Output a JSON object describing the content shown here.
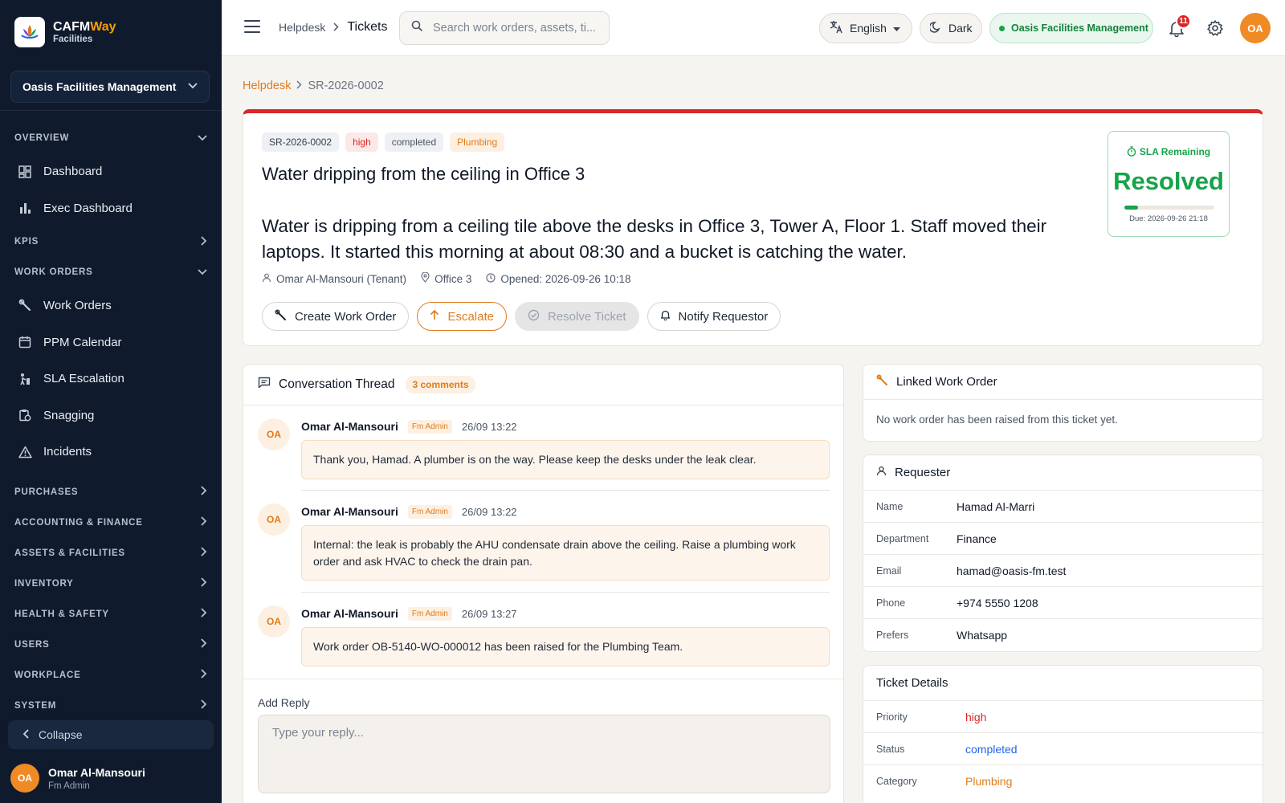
{
  "brand": {
    "name_main": "CAFM",
    "name_accent": "Way",
    "subtitle": "Facilities",
    "logo_icon": "lotus-logo"
  },
  "sidebar": {
    "org_selector": "Oasis Facilities Management",
    "sections": {
      "overview": "OVERVIEW",
      "kpis": "KPIS",
      "work_orders": "WORK ORDERS",
      "purchases": "PURCHASES",
      "accounting": "ACCOUNTING & FINANCE",
      "assets": "ASSETS & FACILITIES",
      "inventory": "INVENTORY",
      "health": "HEALTH & SAFETY",
      "users": "USERS",
      "workplace": "WORKPLACE",
      "system": "SYSTEM"
    },
    "items": {
      "dashboard": "Dashboard",
      "exec_dashboard": "Exec Dashboard",
      "work_orders": "Work Orders",
      "ppm_calendar": "PPM Calendar",
      "sla_escalation": "SLA Escalation",
      "snagging": "Snagging",
      "incidents": "Incidents"
    },
    "collapse_label": "Collapse",
    "user": {
      "initials": "OA",
      "name": "Omar Al-Mansouri",
      "role": "Fm Admin"
    }
  },
  "topbar": {
    "breadcrumb_parent": "Helpdesk",
    "breadcrumb_current": "Tickets",
    "search_placeholder": "Search work orders, assets, ti...",
    "language": "English",
    "theme_toggle": "Dark",
    "org_badge": "Oasis Facilities Management",
    "notifications_count": "11",
    "avatar_initials": "OA"
  },
  "page": {
    "breadcrumb_link": "Helpdesk",
    "breadcrumb_current": "SR-2026-0002"
  },
  "ticket": {
    "id": "SR-2026-0002",
    "priority": "high",
    "status": "completed",
    "category": "Plumbing",
    "title": "Water dripping from the ceiling in Office 3",
    "description": "Water is dripping from a ceiling tile above the desks in Office 3, Tower A, Floor 1. Staff moved their laptops. It started this morning at about 08:30 and a bucket is catching the water.",
    "requester_meta": "Omar Al-Mansouri (Tenant)",
    "location_meta": "Office 3",
    "opened_meta": "Opened: 2026-09-26 10:18",
    "accent_color": "#dc2626"
  },
  "actions": {
    "create_work_order": "Create Work Order",
    "escalate": "Escalate",
    "resolve": "Resolve Ticket",
    "notify": "Notify Requestor"
  },
  "sla": {
    "label": "SLA Remaining",
    "value": "Resolved",
    "progress": 0.15,
    "due": "Due: 2026-09-26 21:18",
    "color": "#16a34a"
  },
  "conversation": {
    "title": "Conversation Thread",
    "count": "3 comments",
    "comments": [
      {
        "initials": "OA",
        "author": "Omar Al-Mansouri",
        "role": "Fm Admin",
        "time": "26/09 13:22",
        "body": "Thank you, Hamad. A plumber is on the way. Please keep the desks under the leak clear."
      },
      {
        "initials": "OA",
        "author": "Omar Al-Mansouri",
        "role": "Fm Admin",
        "time": "26/09 13:22",
        "body": "Internal: the leak is probably the AHU condensate drain above the ceiling. Raise a plumbing work order and ask HVAC to check the drain pan."
      },
      {
        "initials": "OA",
        "author": "Omar Al-Mansouri",
        "role": "Fm Admin",
        "time": "26/09 13:27",
        "body": "Work order OB-5140-WO-000012 has been raised for the Plumbing Team."
      }
    ],
    "reply_label": "Add Reply",
    "reply_placeholder": "Type your reply..."
  },
  "linked_work_order": {
    "title": "Linked Work Order",
    "empty": "No work order has been raised from this ticket yet."
  },
  "requester": {
    "title": "Requester",
    "rows": [
      {
        "label": "Name",
        "value": "Hamad Al-Marri"
      },
      {
        "label": "Department",
        "value": "Finance"
      },
      {
        "label": "Email",
        "value": "hamad@oasis-fm.test"
      },
      {
        "label": "Phone",
        "value": "+974 5550 1208"
      },
      {
        "label": "Prefers",
        "value": "Whatsapp"
      }
    ]
  },
  "ticket_details": {
    "title": "Ticket Details",
    "rows": [
      {
        "label": "Priority",
        "value": "high"
      },
      {
        "label": "Status",
        "value": "completed"
      },
      {
        "label": "Category",
        "value": "Plumbing"
      }
    ]
  }
}
